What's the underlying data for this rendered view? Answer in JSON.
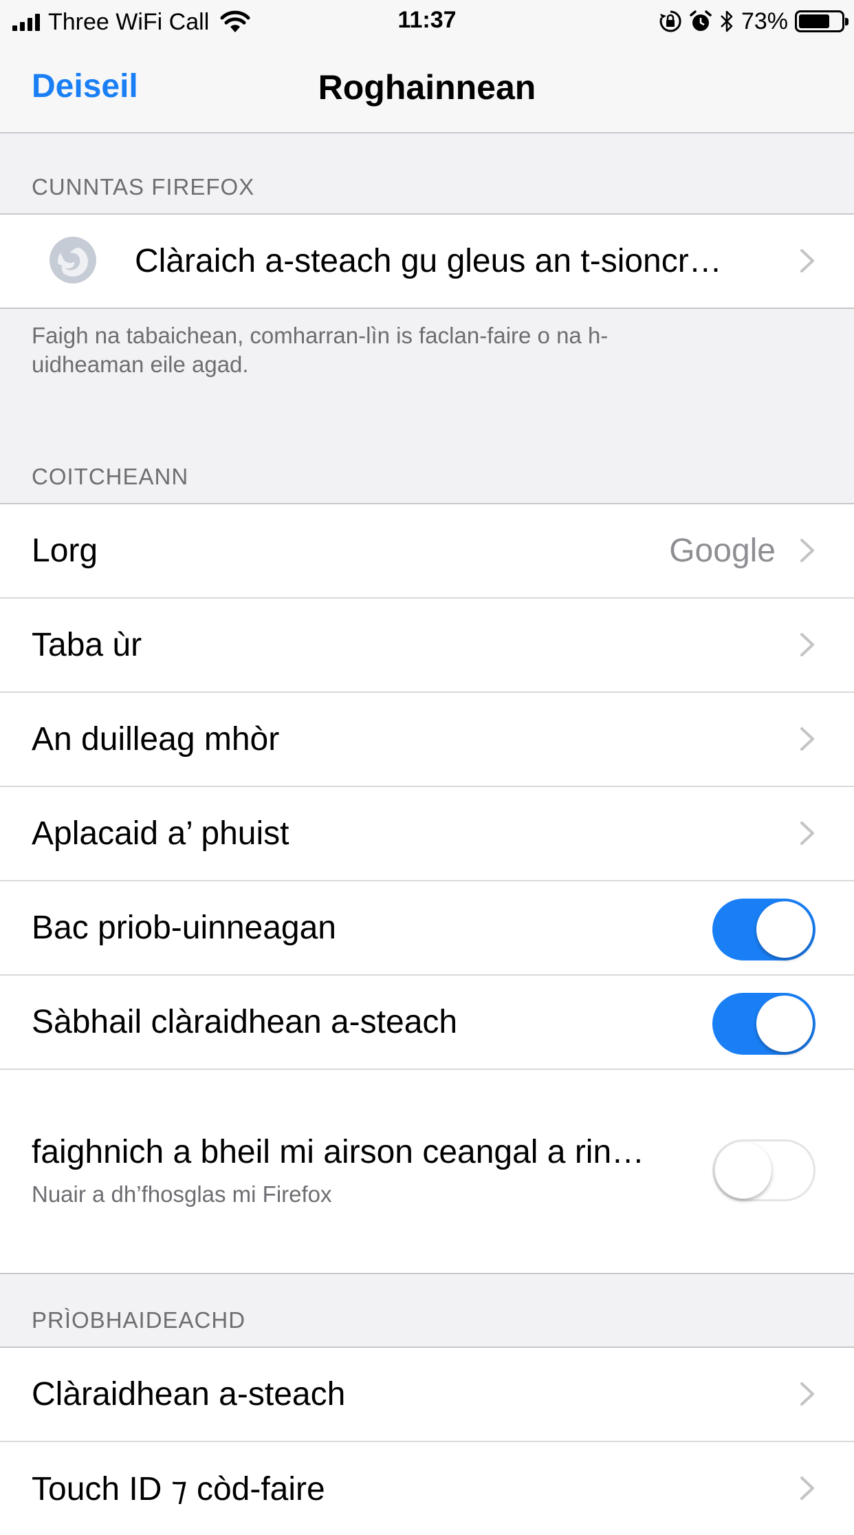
{
  "status_bar": {
    "carrier": "Three WiFi Call",
    "time": "11:37",
    "battery_percent": "73%",
    "battery_level": 0.73
  },
  "nav": {
    "done_label": "Deiseil",
    "title": "Roghainnean"
  },
  "sections": {
    "account": {
      "header": "CUNNTAS FIREFOX",
      "sign_in_label": "Clàraich a-steach gu gleus an t-sioncr…",
      "footer": "Faigh na tabaichean, comharran-lìn is faclan-faire o na h-uidheaman eile agad."
    },
    "general": {
      "header": "COITCHEANN",
      "search_label": "Lorg",
      "search_value": "Google",
      "new_tab_label": "Taba ùr",
      "homepage_label": "An duilleag mhòr",
      "mail_app_label": "Aplacaid a’ phuist",
      "block_popups_label": "Bac priob-uinneagan",
      "block_popups_on": true,
      "save_logins_label": "Sàbhail clàraidhean a-steach",
      "save_logins_on": true,
      "clipboard_label": "faighnich a bheil mi airson ceangal a rin…",
      "clipboard_sub": "Nuair a dh’fhosglas mi Firefox",
      "clipboard_on": false
    },
    "privacy": {
      "header": "PRÌOBHAIDEACHD",
      "logins_label": "Clàraidhean a-steach",
      "touch_id_label": "Touch ID ⁊ còd-faire"
    }
  },
  "icons": {
    "firefox": "firefox-logo-icon",
    "chevron": "chevron-right-icon"
  },
  "colors": {
    "accent": "#1a7ff5",
    "secondary_text": "#6d6d72",
    "value_text": "#8e8e93"
  }
}
